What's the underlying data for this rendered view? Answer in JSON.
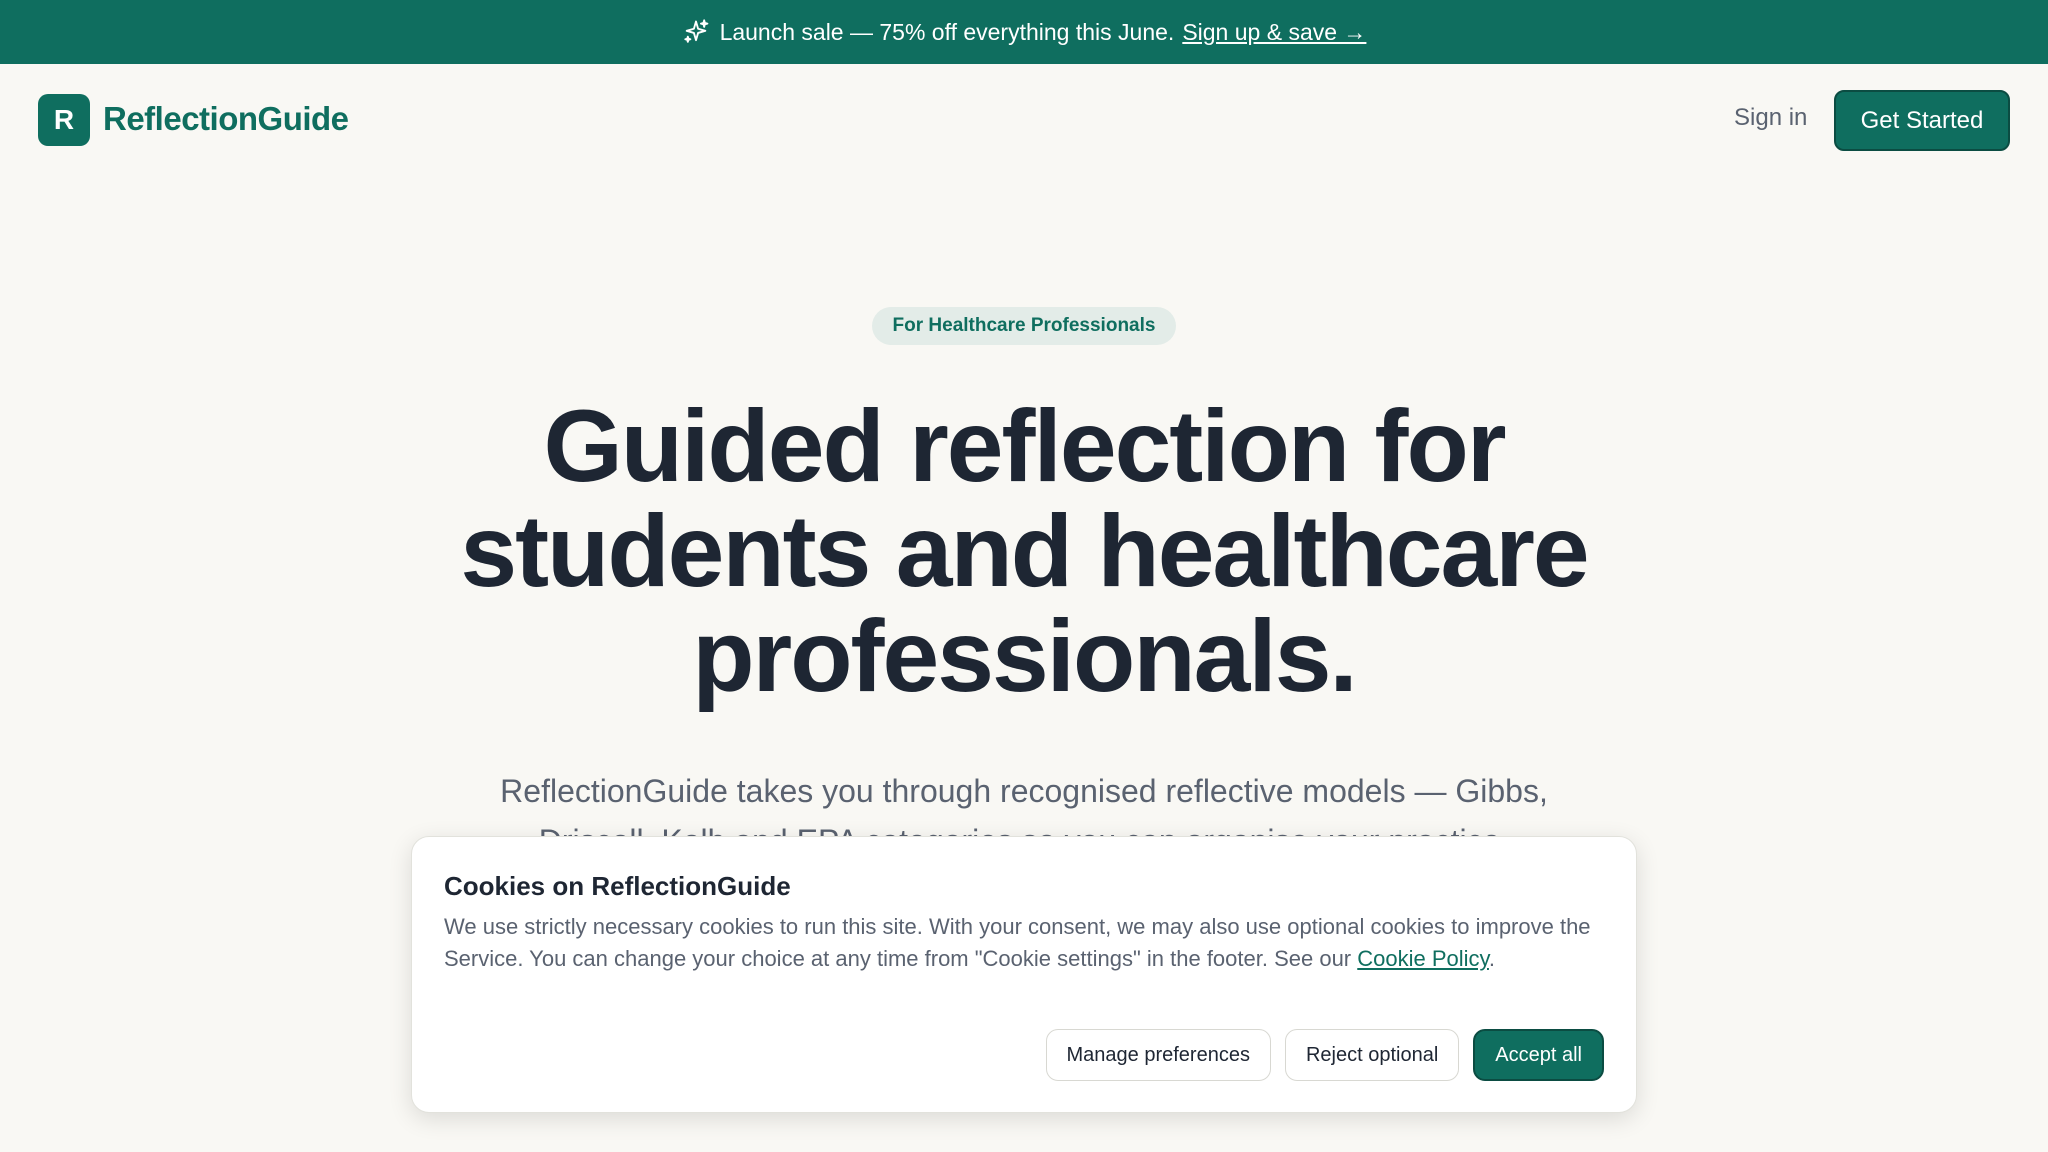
{
  "promo": {
    "text": "Launch sale — 75% off everything this June.",
    "link_label": "Sign up & save →",
    "icon": "sparkle-icon"
  },
  "nav": {
    "logo_letter": "R",
    "brand": "ReflectionGuide",
    "signin_label": "Sign in",
    "cta_label": "Get Started"
  },
  "hero": {
    "badge": "For Healthcare Professionals",
    "headline_line1": "Guided reflection for",
    "headline_line2": "students and healthcare",
    "headline_line3": "professionals.",
    "subtext": "ReflectionGuide takes you through recognised reflective models — Gibbs, Driscoll, Kolb and EPA categories so you can organise your practice."
  },
  "cookie_banner": {
    "title": "Cookies on ReflectionGuide",
    "body": "We use strictly necessary cookies to run this site. With your consent, we may also use optional cookies to improve the Service. You can change your choice at any time from \"Cookie settings\" in the footer. See our",
    "policy_link": "Cookie Policy",
    "body_end": ".",
    "manage_label": "Manage preferences",
    "reject_label": "Reject optional",
    "accept_label": "Accept all"
  },
  "colors": {
    "brand": "#0f6e5f",
    "background": "#f9f8f4",
    "heading": "#1e2633",
    "muted": "#5a6270"
  }
}
